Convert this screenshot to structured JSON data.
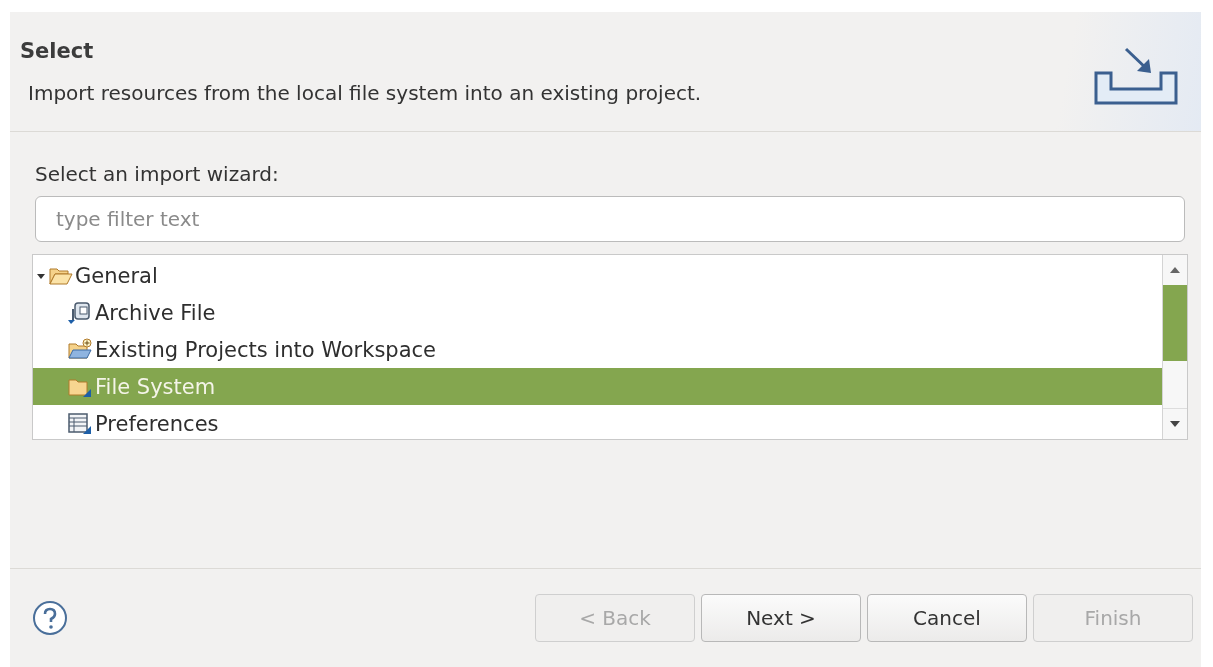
{
  "header": {
    "title": "Select",
    "description": "Import resources from the local file system into an existing project."
  },
  "wizard_label": "Select an import wizard:",
  "filter": {
    "placeholder": "type filter text"
  },
  "tree": [
    {
      "label": "General",
      "kind": "folder",
      "expanded": true,
      "selected": false,
      "children": [
        {
          "label": "Archive File",
          "kind": "archive",
          "selected": false
        },
        {
          "label": "Existing Projects into Workspace",
          "kind": "projects",
          "selected": false
        },
        {
          "label": "File System",
          "kind": "filesystem",
          "selected": true
        },
        {
          "label": "Preferences",
          "kind": "preferences",
          "selected": false
        }
      ]
    }
  ],
  "buttons": [
    {
      "label": "< Back",
      "disabled": true
    },
    {
      "label": "Next >",
      "disabled": false
    },
    {
      "label": "Cancel",
      "disabled": false
    },
    {
      "label": "Finish",
      "disabled": true
    }
  ]
}
